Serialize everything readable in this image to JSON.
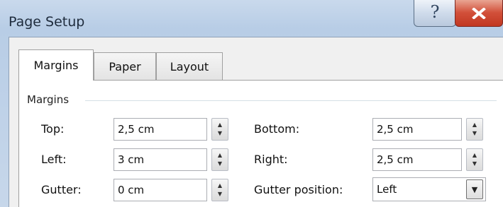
{
  "window": {
    "title": "Page Setup",
    "help_glyph": "?",
    "close_glyph": "✕"
  },
  "tabs": [
    {
      "label": "Margins",
      "active": true
    },
    {
      "label": "Paper",
      "active": false
    },
    {
      "label": "Layout",
      "active": false
    }
  ],
  "margins": {
    "group_label": "Margins",
    "top": {
      "label": "Top:",
      "value": "2,5 cm"
    },
    "left": {
      "label": "Left:",
      "value": "3 cm"
    },
    "gutter": {
      "label": "Gutter:",
      "value": "0 cm"
    },
    "bottom": {
      "label": "Bottom:",
      "value": "2,5 cm"
    },
    "right": {
      "label": "Right:",
      "value": "2,5 cm"
    },
    "gutter_position": {
      "label": "Gutter position:",
      "value": "Left"
    }
  },
  "icons": {
    "spin_up": "▲",
    "spin_down": "▼",
    "dropdown": "▼"
  }
}
